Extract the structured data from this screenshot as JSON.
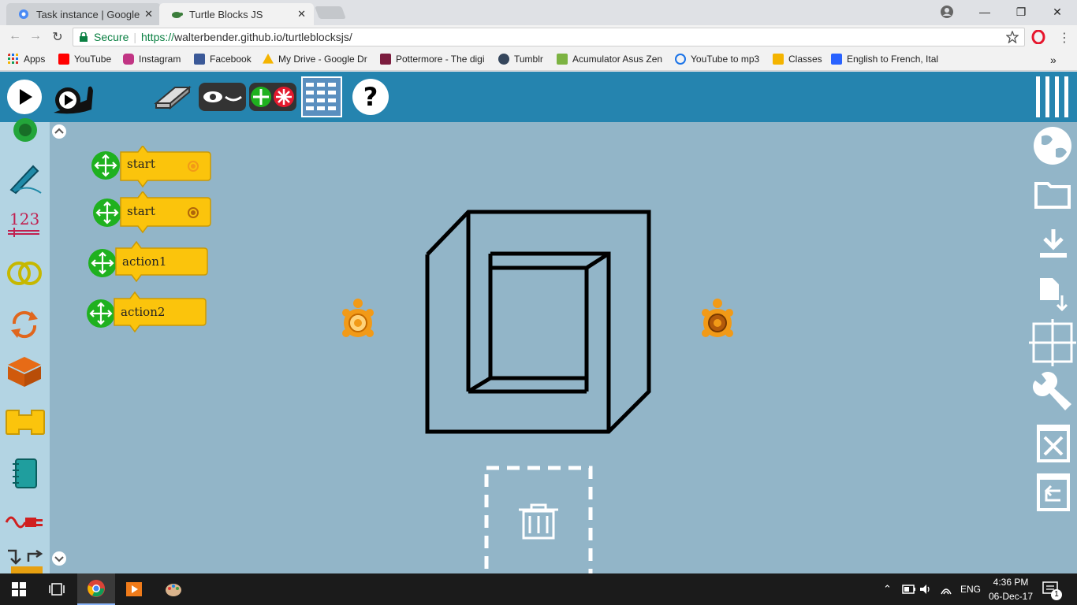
{
  "browser": {
    "tabs": [
      {
        "title": "Task instance | Google Co",
        "close": "✕",
        "active": false
      },
      {
        "title": "Turtle Blocks JS",
        "close": "✕",
        "active": true
      }
    ],
    "window_controls": {
      "minimize": "—",
      "restore": "❐",
      "close": "✕"
    },
    "address": {
      "secure_label": "Secure",
      "scheme": "https://",
      "host": "walterbender.github.io/turtleblocksjs/"
    },
    "bookmarks": [
      {
        "label": "Apps",
        "icon": "apps-grid-icon",
        "color": "#d93025"
      },
      {
        "label": "YouTube",
        "icon": "youtube-icon",
        "color": "#ff0000"
      },
      {
        "label": "Instagram",
        "icon": "instagram-icon",
        "color": "#c13584"
      },
      {
        "label": "Facebook",
        "icon": "facebook-icon",
        "color": "#3b5998"
      },
      {
        "label": "My Drive - Google Dr",
        "icon": "drive-icon",
        "color": "#f4b400"
      },
      {
        "label": "Pottermore - The digi",
        "icon": "pottermore-icon",
        "color": "#7b1c3e"
      },
      {
        "label": "Tumblr",
        "icon": "tumblr-icon",
        "color": "#35465c"
      },
      {
        "label": "Acumulator Asus Zen",
        "icon": "android-icon",
        "color": "#7cb342"
      },
      {
        "label": "YouTube to mp3",
        "icon": "download-cloud-icon",
        "color": "#1a73e8"
      },
      {
        "label": "Classes",
        "icon": "classroom-icon",
        "color": "#f4b400"
      },
      {
        "label": "English to French, Ital",
        "icon": "wordreference-icon",
        "color": "#2962ff"
      }
    ],
    "more_bookmarks": "»"
  },
  "blocks": [
    {
      "label": "start",
      "kind": "start"
    },
    {
      "label": "start",
      "kind": "start"
    },
    {
      "label": "action1",
      "kind": "action"
    },
    {
      "label": "action2",
      "kind": "action"
    }
  ],
  "taskbar": {
    "lang": "ENG",
    "time": "4:36 PM",
    "date": "06-Dec-17",
    "notifications": "1"
  },
  "colors": {
    "app_toolbar": "#2584af",
    "palette_bg": "#b3d4e3",
    "canvas_bg": "#92b5c8",
    "block_fill": "#fbc40c",
    "turtle_orange": "#f29a17"
  }
}
